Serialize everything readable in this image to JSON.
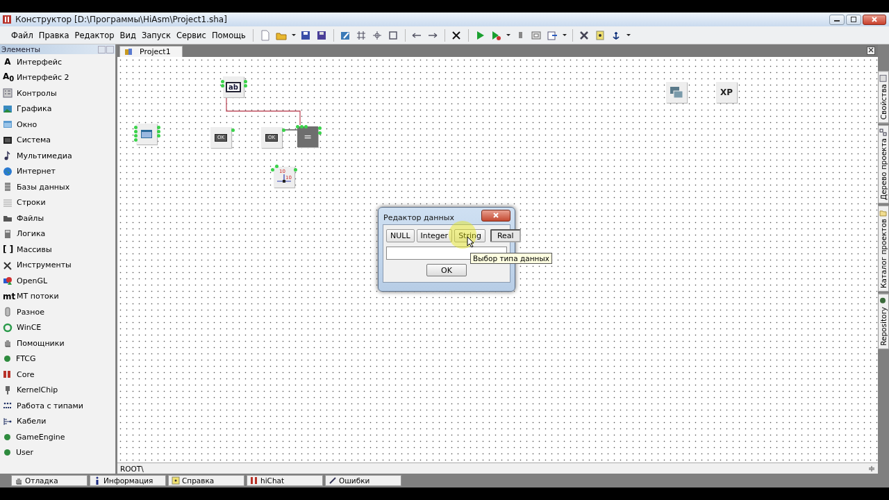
{
  "window": {
    "title": "Конструктор [D:\\Программы\\HiAsm\\Project1.sha]"
  },
  "menu": [
    "Файл",
    "Правка",
    "Редактор",
    "Вид",
    "Запуск",
    "Сервис",
    "Помощь"
  ],
  "elements_panel": {
    "title": "Элементы",
    "items": [
      {
        "label": "Интерфейс",
        "icon_text": "A"
      },
      {
        "label": "Интерфейс 2",
        "icon_text": "A$_{0}$"
      },
      {
        "label": "Контролы"
      },
      {
        "label": "Графика"
      },
      {
        "label": "Окно"
      },
      {
        "label": "Система"
      },
      {
        "label": "Мультимедиа"
      },
      {
        "label": "Интернет"
      },
      {
        "label": "Базы данных"
      },
      {
        "label": "Строки"
      },
      {
        "label": "Файлы"
      },
      {
        "label": "Логика"
      },
      {
        "label": "Массивы",
        "icon_text": "[ ]"
      },
      {
        "label": "Инструменты"
      },
      {
        "label": "OpenGL"
      },
      {
        "label": "МТ потоки",
        "icon_text": "mt"
      },
      {
        "label": "Разное"
      },
      {
        "label": "WinCE"
      },
      {
        "label": "Помощники"
      },
      {
        "label": "FTCG",
        "color": "#2e8b3e"
      },
      {
        "label": "Core"
      },
      {
        "label": "KernelChip"
      },
      {
        "label": "Работа с типами"
      },
      {
        "label": "Кабели"
      },
      {
        "label": "GameEngine",
        "color": "#2e8b3e"
      },
      {
        "label": "User",
        "color": "#2e8b3e"
      }
    ]
  },
  "document_tabs": [
    {
      "label": "Project1",
      "selected": true
    }
  ],
  "canvas": {
    "nodes": [
      {
        "kind": "edit",
        "label": "ab"
      },
      {
        "kind": "form"
      },
      {
        "kind": "button",
        "label": "OK"
      },
      {
        "kind": "button",
        "label": "OK"
      },
      {
        "kind": "compare",
        "label": "="
      },
      {
        "kind": "axis",
        "labels": [
          "10",
          "10"
        ]
      },
      {
        "kind": "windows"
      },
      {
        "kind": "xp",
        "label": "XP"
      }
    ],
    "path": "ROOT\\"
  },
  "right_tabs": [
    "Свойства",
    "Дерево проекта",
    "Каталог проектов",
    "Repository"
  ],
  "bottom_tabs": [
    "Отладка",
    "Информация",
    "Справка",
    "hiChat",
    "Ошибки"
  ],
  "dialog": {
    "title": "Редактор данных",
    "types": [
      {
        "label": "NULL",
        "selected": false
      },
      {
        "label": "Integer",
        "selected": false
      },
      {
        "label": "String",
        "selected": false
      },
      {
        "label": "Real",
        "selected": true
      }
    ],
    "ok": "OK",
    "tooltip": "Выбор типа данных"
  }
}
